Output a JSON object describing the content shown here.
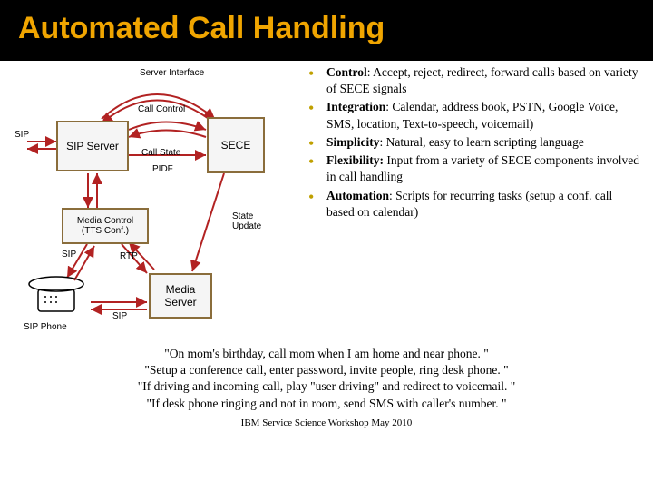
{
  "title": "Automated Call Handling",
  "diagram": {
    "server_interface": "Server Interface",
    "sip_left": "SIP",
    "sip_server": "SIP Server",
    "call_control": "Call Control",
    "sece": "SECE",
    "call_state": "Call State",
    "pidf": "PIDF",
    "media_control": "Media Control\n(TTS Conf.)",
    "state_update": "State\nUpdate",
    "sip_mid": "SIP",
    "rtp": "RTP",
    "media_server": "Media\nServer",
    "sip_bottom": "SIP",
    "sip_phone": "SIP Phone"
  },
  "bullets": [
    {
      "term": "Control",
      "text": ": Accept, reject, redirect, forward calls based on variety of SECE signals"
    },
    {
      "term": "Integration",
      "text": ": Calendar, address book, PSTN, Google Voice, SMS, location, Text-to-speech, voicemail)"
    },
    {
      "term": "Simplicity",
      "text": ": Natural, easy to learn scripting language"
    },
    {
      "term": "Flexibility:",
      "text": " Input from a variety of SECE components  involved in call handling"
    },
    {
      "term": "Automation",
      "text": ": Scripts for recurring tasks (setup a conf. call based on calendar)"
    }
  ],
  "quotes": [
    "\"On mom's birthday, call mom when I am home and near phone. \"",
    "\"Setup a conference call, enter password, invite people, ring desk phone. \"",
    "\"If driving and incoming call, play \"user driving\" and redirect to voicemail. \"",
    "\"If desk phone ringing and not in room, send SMS with caller's number. \""
  ],
  "footer": "IBM Service Science Workshop May 2010"
}
